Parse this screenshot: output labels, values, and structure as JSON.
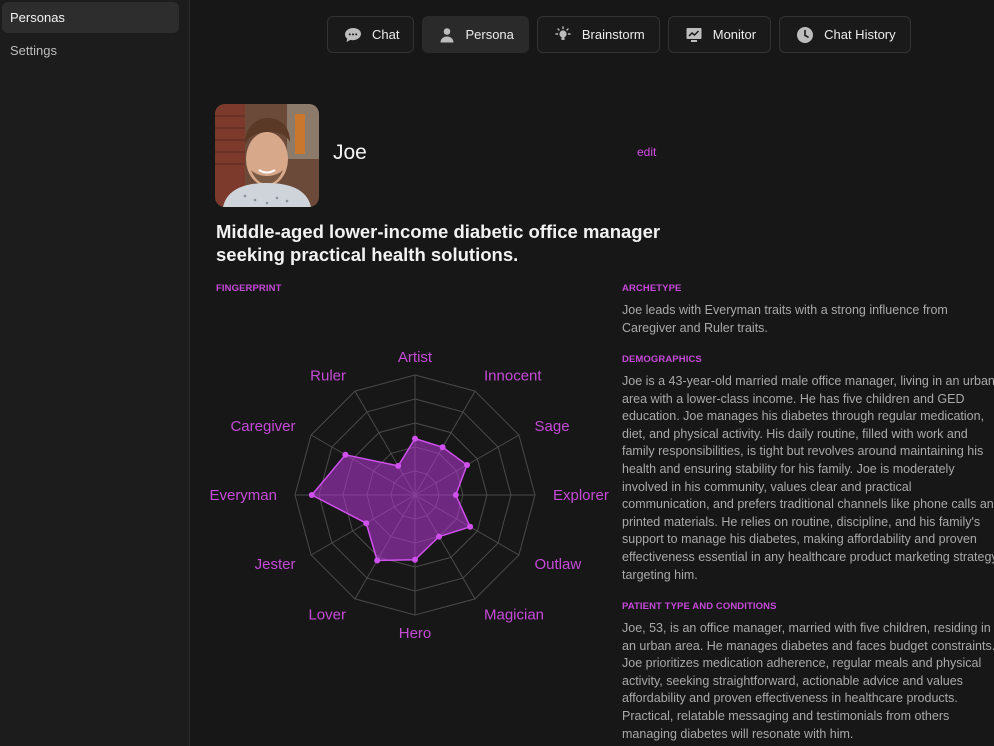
{
  "sidebar": {
    "items": [
      {
        "label": "Personas",
        "active": true
      },
      {
        "label": "Settings",
        "active": false
      }
    ]
  },
  "tabs": [
    {
      "label": "Chat",
      "icon": "chat-bubble-icon"
    },
    {
      "label": "Persona",
      "icon": "person-icon",
      "active": true
    },
    {
      "label": "Brainstorm",
      "icon": "lightbulb-icon"
    },
    {
      "label": "Monitor",
      "icon": "monitor-chart-icon"
    },
    {
      "label": "Chat History",
      "icon": "clock-icon"
    }
  ],
  "persona": {
    "name": "Joe",
    "edit_label": "edit",
    "summary": "Middle-aged lower-income diabetic office manager seeking practical health solutions."
  },
  "fingerprint": {
    "label": "FINGERPRINT",
    "accent_color": "#c64ad8",
    "archetypes": [
      "Artist",
      "Innocent",
      "Sage",
      "Explorer",
      "Outlaw",
      "Magician",
      "Hero",
      "Lover",
      "Jester",
      "Everyman",
      "Caregiver",
      "Ruler"
    ],
    "values": [
      0.47,
      0.46,
      0.5,
      0.34,
      0.53,
      0.4,
      0.54,
      0.63,
      0.47,
      0.86,
      0.67,
      0.28
    ]
  },
  "details": {
    "archetype": {
      "label": "ARCHETYPE",
      "text": "Joe leads with Everyman traits with a strong influence from Caregiver and Ruler traits."
    },
    "demographics": {
      "label": "DEMOGRAPHICS",
      "text": "Joe is a 43-year-old married male office manager, living in an urban area with a lower-class income. He has five children and GED education. Joe manages his diabetes through regular medication, diet, and physical activity. His daily routine, filled with work and family responsibilities, is tight but revolves around maintaining his health and ensuring stability for his family. Joe is moderately involved in his community, values clear and practical communication, and prefers traditional channels like phone calls and printed materials. He relies on routine, discipline, and his family's support to manage his diabetes, making affordability and proven effectiveness essential in any healthcare product marketing strategy targeting him."
    },
    "patient": {
      "label": "PATIENT TYPE AND CONDITIONS",
      "text": "Joe, 53, is an office manager, married with five children, residing in an urban area. He manages diabetes and faces budget constraints. Joe prioritizes medication adherence, regular meals and physical activity, seeking straightforward, actionable advice and values affordability and proven effectiveness in healthcare products. Practical, relatable messaging and testimonials from others managing diabetes will resonate with him."
    }
  }
}
